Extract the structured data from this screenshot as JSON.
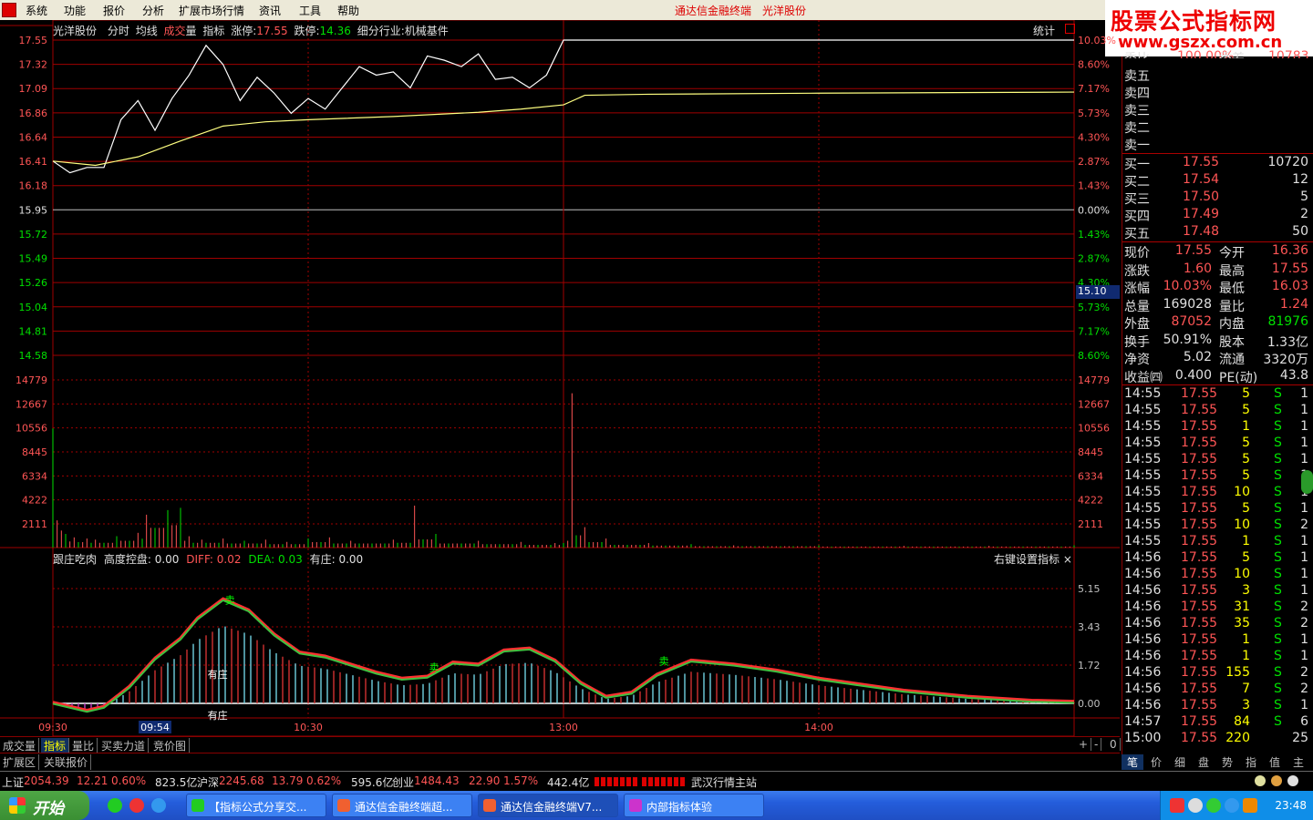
{
  "menu": {
    "items": [
      "系统",
      "功能",
      "报价",
      "分析",
      "扩展市场行情",
      "资讯",
      "工具",
      "帮助"
    ],
    "title_center": "通达信金融终端",
    "title_stock": "光洋股份",
    "brand_line1": "股票公式指标网",
    "brand_line2": "www.gszx.com.cn"
  },
  "chart_header": {
    "stock": "光洋股份",
    "tabs": [
      "分时",
      "均线"
    ],
    "vol_label_1": "成交",
    "vol_label_2": "量",
    "indicator": "指标",
    "limit_up_label": "涨停:",
    "limit_up": "17.55",
    "limit_down_label": "跌停:",
    "limit_down": "14.36",
    "industry": "细分行业:机械基件",
    "stats_button": "统计",
    "cursor_price": "15.10"
  },
  "chart_data": [
    {
      "type": "line",
      "name": "intraday-price",
      "y_ticks_left": [
        "17.55",
        "17.32",
        "17.09",
        "16.86",
        "16.64",
        "16.41",
        "16.18",
        "15.95",
        "15.72",
        "15.49",
        "15.26",
        "15.04",
        "14.81",
        "14.58"
      ],
      "y_ticks_right": [
        "10.03%",
        "8.60%",
        "7.17%",
        "5.73%",
        "4.30%",
        "2.87%",
        "1.43%",
        "0.00%",
        "1.43%",
        "2.87%",
        "4.30%",
        "5.73%",
        "7.17%",
        "8.60%"
      ],
      "ylim": [
        14.58,
        17.55
      ],
      "x_ticks": [
        "09:30",
        "09:54",
        "10:30",
        "13:00",
        "14:00"
      ],
      "series": [
        {
          "name": "price",
          "x_min": [
            0,
            4,
            8,
            12,
            16,
            20,
            24,
            28,
            32,
            36,
            40,
            44,
            48,
            52,
            56,
            60,
            64,
            68,
            72,
            76,
            80,
            84,
            88,
            92,
            96,
            100,
            104,
            108,
            112,
            116,
            120,
            125,
            130,
            140,
            150,
            160,
            170,
            180,
            190,
            200,
            210,
            220,
            230,
            240
          ],
          "values": [
            16.41,
            16.3,
            16.35,
            16.35,
            16.8,
            16.98,
            16.7,
            17.0,
            17.22,
            17.5,
            17.32,
            16.98,
            17.2,
            17.05,
            16.86,
            17.0,
            16.9,
            17.1,
            17.3,
            17.22,
            17.25,
            17.1,
            17.4,
            17.36,
            17.3,
            17.42,
            17.18,
            17.2,
            17.1,
            17.22,
            17.55,
            17.55,
            17.55,
            17.55,
            17.55,
            17.55,
            17.55,
            17.55,
            17.55,
            17.55,
            17.55,
            17.55,
            17.55,
            17.55
          ]
        },
        {
          "name": "avg",
          "x_min": [
            0,
            10,
            20,
            30,
            40,
            50,
            60,
            80,
            100,
            110,
            120,
            125,
            140,
            180,
            240
          ],
          "values": [
            16.41,
            16.37,
            16.45,
            16.6,
            16.74,
            16.78,
            16.8,
            16.83,
            16.87,
            16.9,
            16.94,
            17.03,
            17.04,
            17.05,
            17.06
          ]
        }
      ]
    },
    {
      "type": "bar",
      "name": "volume",
      "y_ticks": [
        "14779",
        "12667",
        "10556",
        "8445",
        "6334",
        "4222",
        "2111"
      ],
      "ylim": [
        0,
        14779
      ],
      "x_min": [
        0,
        1,
        2,
        3,
        5,
        8,
        10,
        15,
        20,
        22,
        27,
        30,
        32,
        35,
        40,
        45,
        50,
        55,
        60,
        65,
        70,
        80,
        85,
        90,
        100,
        110,
        118,
        120,
        121,
        122,
        125,
        130,
        140,
        150,
        160,
        180,
        200,
        220,
        240
      ],
      "values": [
        10500,
        2400,
        1500,
        1200,
        900,
        800,
        700,
        1000,
        1300,
        2900,
        3300,
        3500,
        1000,
        700,
        800,
        600,
        700,
        500,
        800,
        900,
        600,
        700,
        3700,
        1200,
        600,
        500,
        400,
        400,
        600,
        13600,
        1800,
        800,
        400,
        300,
        200,
        200,
        150,
        150,
        200
      ]
    },
    {
      "type": "area",
      "name": "跟庄吃肉",
      "labels": [
        "跟庄吃肉",
        "高度控盘:",
        "0.00",
        "DIFF:",
        "0.02",
        "DEA:",
        "0.03",
        "有庄:",
        "0.00"
      ],
      "y_ticks": [
        "5.15",
        "3.43",
        "1.72",
        "0.00"
      ],
      "ylim": [
        -0.5,
        5.6
      ],
      "x_min": [
        0,
        8,
        12,
        18,
        24,
        30,
        34,
        40,
        46,
        52,
        58,
        64,
        70,
        76,
        82,
        88,
        94,
        100,
        106,
        112,
        118,
        124,
        130,
        136,
        142,
        150,
        160,
        170,
        180,
        190,
        200,
        215,
        230,
        240
      ],
      "values": [
        0,
        -0.4,
        -0.2,
        0.8,
        2.2,
        3.2,
        4.2,
        5.15,
        4.6,
        3.4,
        2.5,
        2.3,
        1.9,
        1.5,
        1.2,
        1.3,
        2.0,
        1.9,
        2.6,
        2.7,
        2.1,
        1.0,
        0.3,
        0.5,
        1.4,
        2.1,
        1.9,
        1.6,
        1.2,
        0.9,
        0.6,
        0.3,
        0.1,
        0.05
      ],
      "annotations": [
        "有庄",
        "有庄",
        "卖",
        "卖",
        "卖"
      ]
    }
  ],
  "sub_panel": {
    "right_hint": "右键设置指标",
    "close": "×"
  },
  "quote_panel": {
    "top_cut": [
      "委比",
      "100.00%",
      "委差",
      "10783"
    ],
    "sell": [
      {
        "label": "卖五",
        "price": "",
        "vol": ""
      },
      {
        "label": "卖四",
        "price": "",
        "vol": ""
      },
      {
        "label": "卖三",
        "price": "",
        "vol": ""
      },
      {
        "label": "卖二",
        "price": "",
        "vol": ""
      },
      {
        "label": "卖一",
        "price": "",
        "vol": ""
      }
    ],
    "buy": [
      {
        "label": "买一",
        "price": "17.55",
        "vol": "10720"
      },
      {
        "label": "买二",
        "price": "17.54",
        "vol": "12"
      },
      {
        "label": "买三",
        "price": "17.50",
        "vol": "5"
      },
      {
        "label": "买四",
        "price": "17.49",
        "vol": "2"
      },
      {
        "label": "买五",
        "price": "17.48",
        "vol": "50"
      }
    ],
    "stats": [
      [
        "现价",
        "17.55",
        "今开",
        "16.36"
      ],
      [
        "涨跌",
        "1.60",
        "最高",
        "17.55"
      ],
      [
        "涨幅",
        "10.03%",
        "最低",
        "16.03"
      ],
      [
        "总量",
        "169028",
        "量比",
        "1.24"
      ],
      [
        "外盘",
        "87052",
        "内盘",
        "81976"
      ],
      [
        "换手",
        "50.91%",
        "股本",
        "1.33亿"
      ],
      [
        "净资",
        "5.02",
        "流通",
        "3320万"
      ],
      [
        "收益㈣",
        "0.400",
        "PE(动)",
        "43.8"
      ]
    ],
    "ticks": [
      [
        "14:55",
        "17.55",
        "5",
        "S",
        "1"
      ],
      [
        "14:55",
        "17.55",
        "5",
        "S",
        "1"
      ],
      [
        "14:55",
        "17.55",
        "1",
        "S",
        "1"
      ],
      [
        "14:55",
        "17.55",
        "5",
        "S",
        "1"
      ],
      [
        "14:55",
        "17.55",
        "5",
        "S",
        "1"
      ],
      [
        "14:55",
        "17.55",
        "5",
        "S",
        "1"
      ],
      [
        "14:55",
        "17.55",
        "10",
        "S",
        "1"
      ],
      [
        "14:55",
        "17.55",
        "5",
        "S",
        "1"
      ],
      [
        "14:55",
        "17.55",
        "10",
        "S",
        "2"
      ],
      [
        "14:55",
        "17.55",
        "1",
        "S",
        "1"
      ],
      [
        "14:56",
        "17.55",
        "5",
        "S",
        "1"
      ],
      [
        "14:56",
        "17.55",
        "10",
        "S",
        "1"
      ],
      [
        "14:56",
        "17.55",
        "3",
        "S",
        "1"
      ],
      [
        "14:56",
        "17.55",
        "31",
        "S",
        "2"
      ],
      [
        "14:56",
        "17.55",
        "35",
        "S",
        "2"
      ],
      [
        "14:56",
        "17.55",
        "1",
        "S",
        "1"
      ],
      [
        "14:56",
        "17.55",
        "1",
        "S",
        "1"
      ],
      [
        "14:56",
        "17.55",
        "155",
        "S",
        "2"
      ],
      [
        "14:56",
        "17.55",
        "7",
        "S",
        "2"
      ],
      [
        "14:56",
        "17.55",
        "3",
        "S",
        "1"
      ],
      [
        "14:57",
        "17.55",
        "84",
        "S",
        "6"
      ],
      [
        "15:00",
        "17.55",
        "220",
        "",
        "25"
      ]
    ]
  },
  "bottom_tabs": {
    "row1": [
      "成交量",
      "指标",
      "量比",
      "买卖力道",
      "竞价图"
    ],
    "row2": [
      "扩展区",
      "关联报价"
    ],
    "controls": [
      "+",
      "-",
      "0"
    ],
    "right_tabs": [
      "笔",
      "价",
      "细",
      "盘",
      "势",
      "指",
      "值",
      "主"
    ]
  },
  "status_bar": {
    "sh_label": "上证",
    "sh_val": "2054.39",
    "sh_chg": "12.21",
    "sh_pct": "0.60%",
    "sh_amt": "823.5亿",
    "sz_label": "沪深",
    "sz_val": "2245.68",
    "sz_chg": "13.79",
    "sz_pct": "0.62%",
    "sz_amt": "595.6亿",
    "cy_label": "创业",
    "cy_val": "1484.43",
    "cy_chg": "22.90",
    "cy_pct": "1.57%",
    "cy_amt": "442.4亿",
    "server": "武汉行情主站"
  },
  "taskbar": {
    "start": "开始",
    "windows": [
      "【指标公式分享交...",
      "通达信金融终端超...",
      "通达信金融终端V7...",
      "内部指标体验"
    ],
    "clock": "23:48"
  },
  "colors": {
    "up": "#ff5555",
    "down": "#00e000",
    "grid": "#a00000",
    "accent": "#ffff00"
  }
}
